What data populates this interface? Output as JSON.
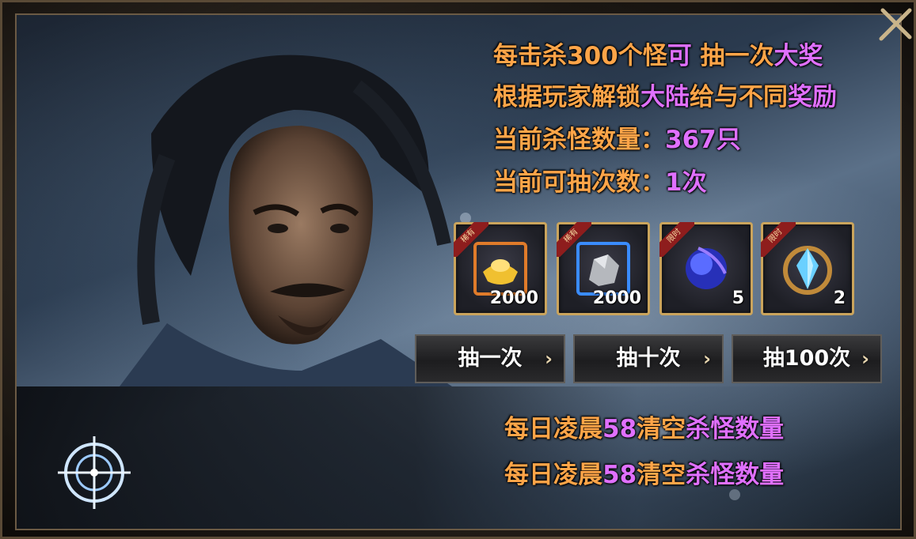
{
  "info": {
    "line1": {
      "a": "每击杀300个怪",
      "b": "可",
      "c": "抽一次",
      "d": "大奖"
    },
    "line2": {
      "a": "根据玩家解锁",
      "b": "大陆",
      "c": "给与不同",
      "d": "奖励"
    },
    "line3": {
      "label": "当前杀怪数量：",
      "value": "367只"
    },
    "line4": {
      "label": "当前可抽次数：",
      "value": "1次"
    }
  },
  "rewards": [
    {
      "icon": "gold-ingot-icon",
      "tag": "稀有",
      "count": "2000"
    },
    {
      "icon": "silver-ore-icon",
      "tag": "稀有",
      "count": "2000"
    },
    {
      "icon": "blue-orb-icon",
      "tag": "限时",
      "count": "5"
    },
    {
      "icon": "blue-crystal-icon",
      "tag": "限时",
      "count": "2"
    }
  ],
  "buttons": {
    "draw_once": "抽一次",
    "draw_ten": "抽十次",
    "draw_hundred": "抽100次",
    "arrow": "›"
  },
  "notes": [
    {
      "a": "每日凌晨",
      "b": "58",
      "c": "清空",
      "d": "杀怪数量"
    },
    {
      "a": "每日凌晨",
      "b": "58",
      "c": "清空",
      "d": "杀怪数量"
    }
  ],
  "colors": {
    "orange": "#ffa548",
    "magenta": "#e070ff",
    "gold_border": "#caa45c"
  }
}
